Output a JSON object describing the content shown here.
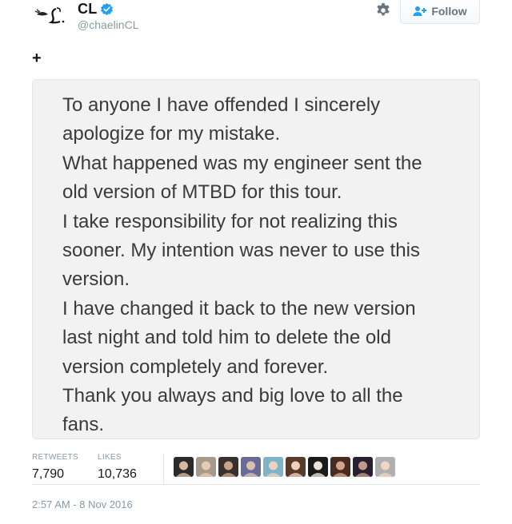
{
  "user": {
    "display_name": "CL",
    "handle": "@chaelinCL",
    "verified": true,
    "verified_color": "#1da1f2"
  },
  "actions": {
    "follow_label": "Follow",
    "settings_icon": "gear-icon"
  },
  "tweet": {
    "expand_label": "+",
    "image_text_lines": [
      "To anyone I have offended I sincerely",
      "apologize for my mistake.",
      "What happened was my engineer sent the",
      "old version of MTBD for this tour.",
      "I take responsibility for not realizing this",
      "sooner. My intention was never to use this",
      "version.",
      "I have changed it back to the new version",
      "last night and told him to delete the old",
      "version completely and forever.",
      "Thank you always and big love to all the",
      "fans."
    ]
  },
  "stats": {
    "retweets_label": "RETWEETS",
    "retweets_value": "7,790",
    "likes_label": "LIKES",
    "likes_value": "10,736"
  },
  "likers_count": 10,
  "timestamp": "2:57 AM - 8 Nov 2016",
  "colors": {
    "muted_text": "#8899a6",
    "border": "#e1e8ed",
    "photo_bg": "#f2f2f2"
  }
}
